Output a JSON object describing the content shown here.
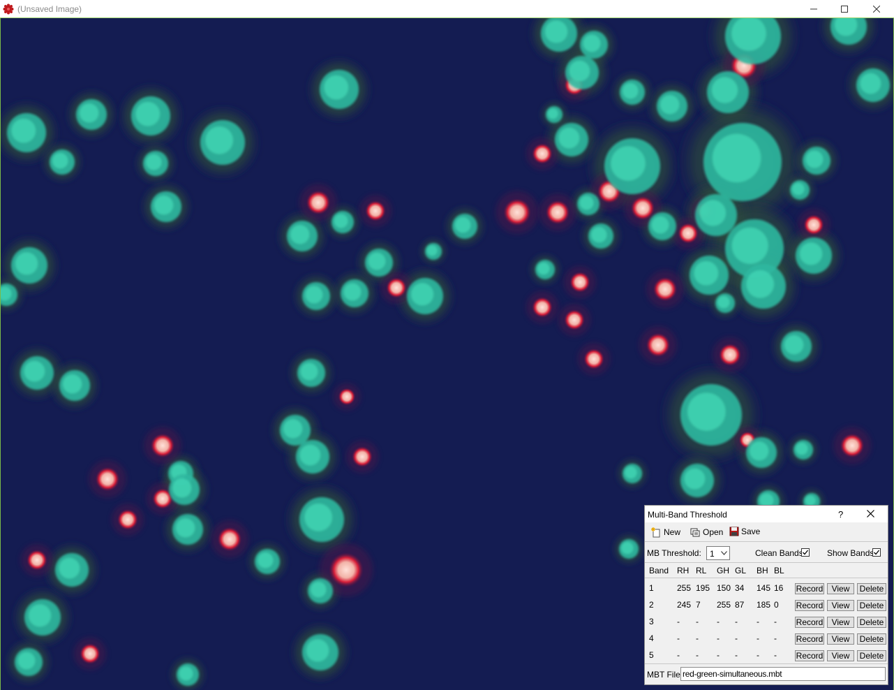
{
  "window": {
    "title": "(Unsaved Image)",
    "accent_color": "#79b94a"
  },
  "dialog": {
    "title": "Multi-Band Threshold",
    "help_label": "?",
    "toolbar": {
      "new_label": "New",
      "open_label": "Open",
      "save_label": "Save"
    },
    "controls": {
      "mb_threshold_label": "MB Threshold:",
      "mb_threshold_value": "1",
      "clean_bands_label": "Clean Bands",
      "clean_bands_checked": true,
      "show_bands_label": "Show Bands",
      "show_bands_checked": true
    },
    "table": {
      "headers": [
        "Band",
        "RH",
        "RL",
        "GH",
        "GL",
        "BH",
        "BL"
      ],
      "rows": [
        {
          "band": "1",
          "rh": "255",
          "rl": "195",
          "gh": "150",
          "gl": "34",
          "bh": "145",
          "bl": "16"
        },
        {
          "band": "2",
          "rh": "245",
          "rl": "7",
          "gh": "255",
          "gl": "87",
          "bh": "185",
          "bl": "0"
        },
        {
          "band": "3",
          "rh": "-",
          "rl": "-",
          "gh": "-",
          "gl": "-",
          "bh": "-",
          "bl": "-"
        },
        {
          "band": "4",
          "rh": "-",
          "rl": "-",
          "gh": "-",
          "gl": "-",
          "bh": "-",
          "bl": "-"
        },
        {
          "band": "5",
          "rh": "-",
          "rl": "-",
          "gh": "-",
          "gl": "-",
          "bh": "-",
          "bl": "-"
        }
      ],
      "record_label": "Record",
      "view_label": "View",
      "delete_label": "Delete"
    },
    "mbt_file_label": "MBT File:",
    "mbt_file_value": "red-green-simultaneous.mbt"
  }
}
